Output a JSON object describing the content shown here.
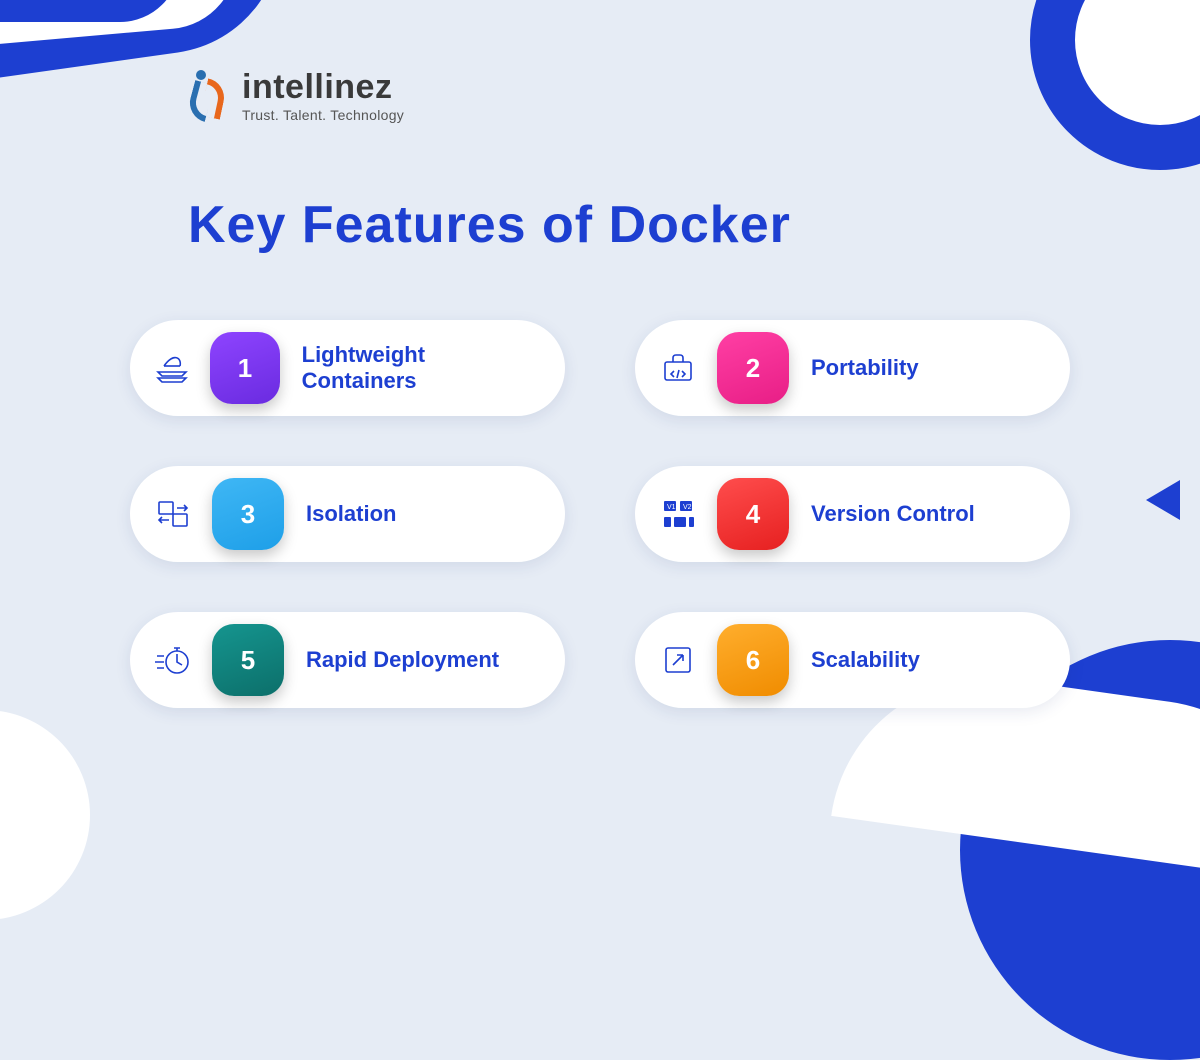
{
  "logo": {
    "brand": "intellinez",
    "tagline": "Trust. Talent. Technology"
  },
  "title": "Key Features of Docker",
  "features": [
    {
      "num": "1",
      "label": "Lightweight Containers",
      "icon": "feather-layers-icon",
      "color": "c1"
    },
    {
      "num": "2",
      "label": "Portability",
      "icon": "briefcase-code-icon",
      "color": "c2"
    },
    {
      "num": "3",
      "label": "Isolation",
      "icon": "swap-panels-icon",
      "color": "c3"
    },
    {
      "num": "4",
      "label": "Version Control",
      "icon": "version-blocks-icon",
      "color": "c4"
    },
    {
      "num": "5",
      "label": "Rapid Deployment",
      "icon": "stopwatch-speed-icon",
      "color": "c5"
    },
    {
      "num": "6",
      "label": "Scalability",
      "icon": "expand-icon",
      "color": "c6"
    }
  ],
  "colors": {
    "accent": "#1d3fd1",
    "background": "#e6ecf5"
  }
}
